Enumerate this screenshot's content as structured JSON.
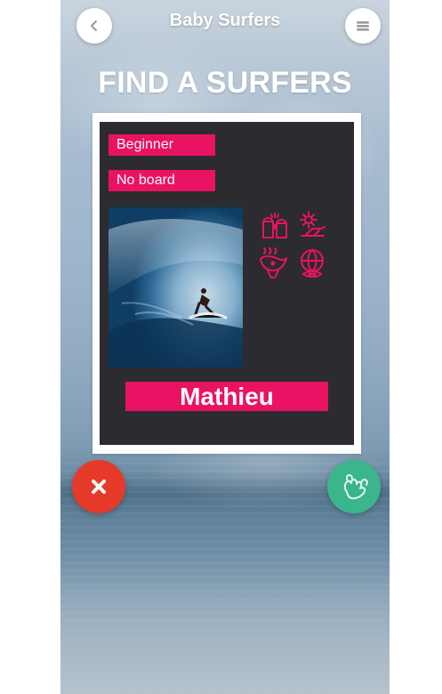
{
  "header": {
    "app_title": "Baby Surfers",
    "page_title": "FIND A SURFERS"
  },
  "profile": {
    "level": "Beginner",
    "board": "No board",
    "name": "Mathieu",
    "photo_icon": "surfer-wave-photo",
    "interests": [
      {
        "icon": "beer-icon"
      },
      {
        "icon": "beach-lounger-icon"
      },
      {
        "icon": "food-icon"
      },
      {
        "icon": "sports-icon"
      }
    ]
  },
  "actions": {
    "reject_icon": "close-icon",
    "accept_icon": "shaka-icon"
  },
  "colors": {
    "accent_pink": "#ea1263",
    "reject_red": "#e53a2a",
    "accept_green": "#3bb58b",
    "card_dark": "#2b2b30"
  }
}
